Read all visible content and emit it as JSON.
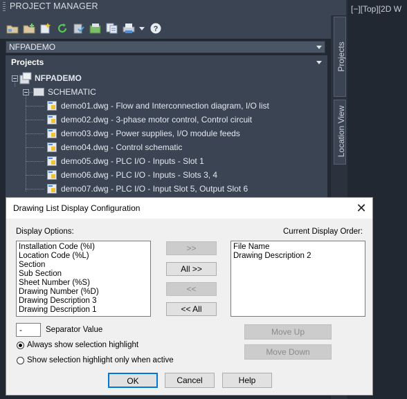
{
  "pm": {
    "title": "PROJECT MANAGER",
    "viewport_label": "[−][Top][2D W",
    "project_select": {
      "value": "NFPADEMO"
    },
    "projects_header": "Projects",
    "toolbar_icons": [
      "open-project-icon",
      "new-project-icon",
      "new-drawing-icon",
      "refresh-icon",
      "update-icon",
      "task-list-icon",
      "batch-plot-icon",
      "publish-icon",
      "dropdown-arrow-icon",
      "help-icon"
    ],
    "tree": {
      "root": "NFPADEMO",
      "folder": "SCHEMATIC",
      "drawings": [
        "demo01.dwg - Flow and Interconnection diagram, I/O list",
        "demo02.dwg - 3-phase motor control, Control circuit",
        "demo03.dwg - Power supplies, I/O module feeds",
        "demo04.dwg - Control schematic",
        "demo05.dwg - PLC I/O - Inputs - Slot 1",
        "demo06.dwg - PLC I/O - Inputs - Slots 3, 4",
        "demo07.dwg - PLC I/O - Input Slot 5, Output Slot 6"
      ]
    },
    "side_tabs": {
      "projects": "Projects",
      "location_view": "Location View"
    }
  },
  "dialog": {
    "title": "Drawing List Display Configuration",
    "close": "✕",
    "display_options_label": "Display Options:",
    "display_options": [
      "Installation Code (%I)",
      "Location Code (%L)",
      "Section",
      "Sub Section",
      "Sheet Number (%S)",
      "Drawing Number (%D)",
      "Drawing Description 3",
      "Drawing Description 1"
    ],
    "current_order_label": "Current Display Order:",
    "current_order": [
      "File Name",
      "Drawing Description 2"
    ],
    "buttons": {
      "add": ">>",
      "add_all": "All >>",
      "remove": "<<",
      "remove_all": "<< All",
      "move_up": "Move Up",
      "move_down": "Move Down",
      "ok": "OK",
      "cancel": "Cancel",
      "help": "Help"
    },
    "separator_value": "-",
    "separator_label": "Separator Value",
    "radio_always": "Always show selection highlight",
    "radio_focus": "Show selection highlight only when active"
  }
}
